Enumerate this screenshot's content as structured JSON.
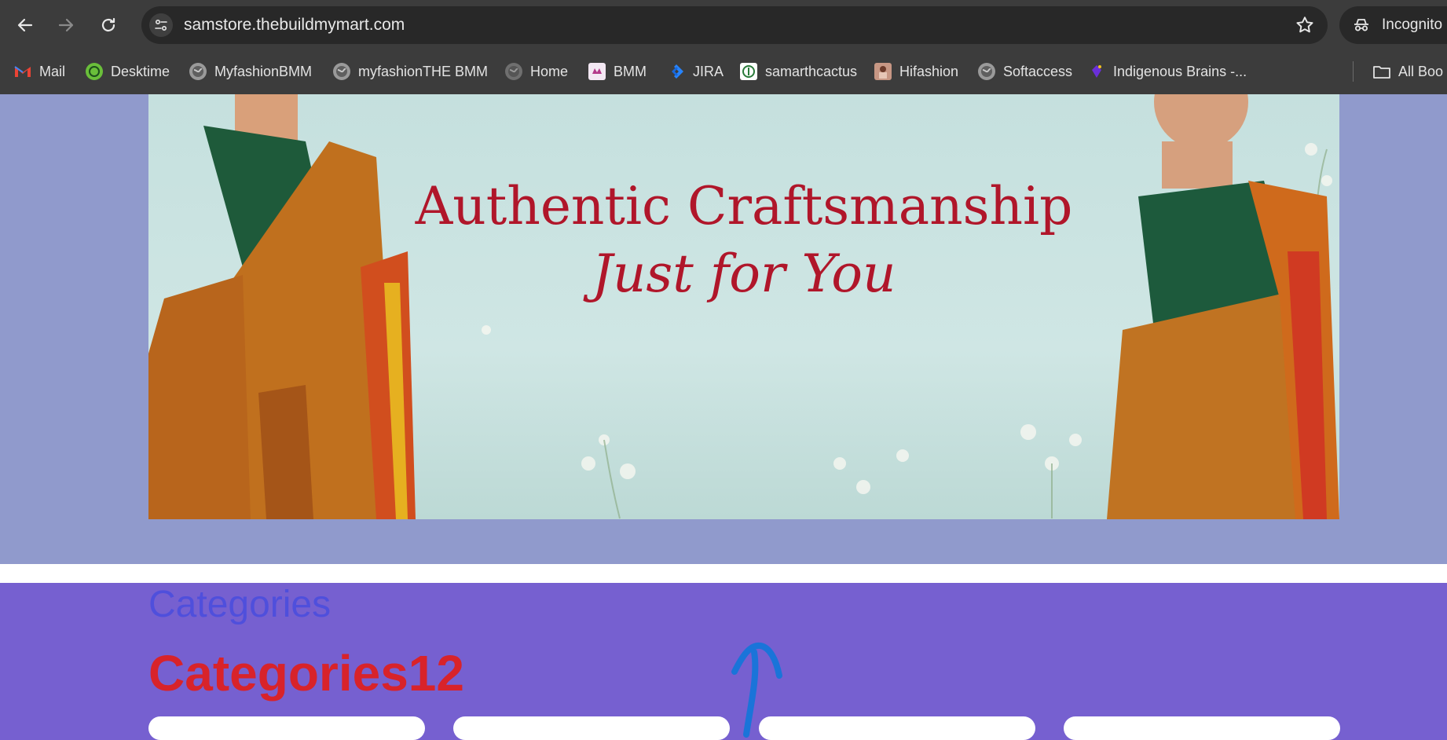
{
  "browser": {
    "url": "samstore.thebuildmymart.com",
    "incognito_label": "Incognito",
    "icons": [
      "back-arrow-icon",
      "forward-arrow-icon",
      "reload-icon",
      "site-info-icon",
      "star-icon",
      "incognito-icon"
    ]
  },
  "bookmarks": {
    "items": [
      {
        "label": "Mail",
        "icon": "gmail-icon"
      },
      {
        "label": "Desktime",
        "icon": "desktime-icon"
      },
      {
        "label": "MyfashionBMM",
        "icon": "globe-icon"
      },
      {
        "label": "myfashionTHE BMM",
        "icon": "globe-icon"
      },
      {
        "label": "Home",
        "icon": "globe-icon"
      },
      {
        "label": "BMM",
        "icon": "bmm-icon"
      },
      {
        "label": "JIRA",
        "icon": "jira-icon"
      },
      {
        "label": "samarthcactus",
        "icon": "cactus-icon"
      },
      {
        "label": "Hifashion",
        "icon": "hifashion-icon"
      },
      {
        "label": "Softaccess",
        "icon": "globe-icon"
      },
      {
        "label": "Indigenous Brains -...",
        "icon": "indigenous-icon"
      }
    ],
    "all_bookmarks_label": "All Boo"
  },
  "banner": {
    "line1": "Authentic Craftsmanship",
    "line2": "Just for You"
  },
  "categories": {
    "title": "Categories",
    "subtitle": "Categories12"
  },
  "colors": {
    "hero_band": "#909acc",
    "section_bg": "#7660d0",
    "headline": "#b0162a",
    "cat_title": "#4f4fdc",
    "cat_subtitle": "#d8232a",
    "annotation_arrow": "#1a74d9"
  }
}
